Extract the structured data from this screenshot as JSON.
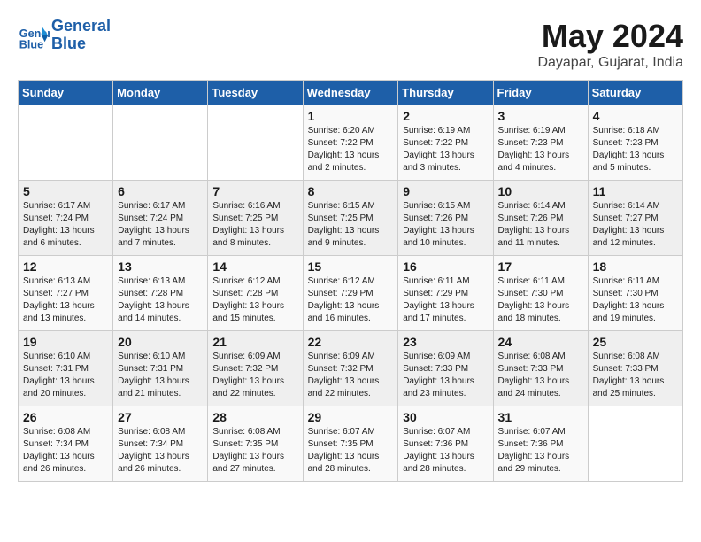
{
  "logo": {
    "line1": "General",
    "line2": "Blue"
  },
  "title": "May 2024",
  "subtitle": "Dayapar, Gujarat, India",
  "headers": [
    "Sunday",
    "Monday",
    "Tuesday",
    "Wednesday",
    "Thursday",
    "Friday",
    "Saturday"
  ],
  "weeks": [
    [
      {
        "num": "",
        "sunrise": "",
        "sunset": "",
        "daylight": ""
      },
      {
        "num": "",
        "sunrise": "",
        "sunset": "",
        "daylight": ""
      },
      {
        "num": "",
        "sunrise": "",
        "sunset": "",
        "daylight": ""
      },
      {
        "num": "1",
        "sunrise": "Sunrise: 6:20 AM",
        "sunset": "Sunset: 7:22 PM",
        "daylight": "Daylight: 13 hours and 2 minutes."
      },
      {
        "num": "2",
        "sunrise": "Sunrise: 6:19 AM",
        "sunset": "Sunset: 7:22 PM",
        "daylight": "Daylight: 13 hours and 3 minutes."
      },
      {
        "num": "3",
        "sunrise": "Sunrise: 6:19 AM",
        "sunset": "Sunset: 7:23 PM",
        "daylight": "Daylight: 13 hours and 4 minutes."
      },
      {
        "num": "4",
        "sunrise": "Sunrise: 6:18 AM",
        "sunset": "Sunset: 7:23 PM",
        "daylight": "Daylight: 13 hours and 5 minutes."
      }
    ],
    [
      {
        "num": "5",
        "sunrise": "Sunrise: 6:17 AM",
        "sunset": "Sunset: 7:24 PM",
        "daylight": "Daylight: 13 hours and 6 minutes."
      },
      {
        "num": "6",
        "sunrise": "Sunrise: 6:17 AM",
        "sunset": "Sunset: 7:24 PM",
        "daylight": "Daylight: 13 hours and 7 minutes."
      },
      {
        "num": "7",
        "sunrise": "Sunrise: 6:16 AM",
        "sunset": "Sunset: 7:25 PM",
        "daylight": "Daylight: 13 hours and 8 minutes."
      },
      {
        "num": "8",
        "sunrise": "Sunrise: 6:15 AM",
        "sunset": "Sunset: 7:25 PM",
        "daylight": "Daylight: 13 hours and 9 minutes."
      },
      {
        "num": "9",
        "sunrise": "Sunrise: 6:15 AM",
        "sunset": "Sunset: 7:26 PM",
        "daylight": "Daylight: 13 hours and 10 minutes."
      },
      {
        "num": "10",
        "sunrise": "Sunrise: 6:14 AM",
        "sunset": "Sunset: 7:26 PM",
        "daylight": "Daylight: 13 hours and 11 minutes."
      },
      {
        "num": "11",
        "sunrise": "Sunrise: 6:14 AM",
        "sunset": "Sunset: 7:27 PM",
        "daylight": "Daylight: 13 hours and 12 minutes."
      }
    ],
    [
      {
        "num": "12",
        "sunrise": "Sunrise: 6:13 AM",
        "sunset": "Sunset: 7:27 PM",
        "daylight": "Daylight: 13 hours and 13 minutes."
      },
      {
        "num": "13",
        "sunrise": "Sunrise: 6:13 AM",
        "sunset": "Sunset: 7:28 PM",
        "daylight": "Daylight: 13 hours and 14 minutes."
      },
      {
        "num": "14",
        "sunrise": "Sunrise: 6:12 AM",
        "sunset": "Sunset: 7:28 PM",
        "daylight": "Daylight: 13 hours and 15 minutes."
      },
      {
        "num": "15",
        "sunrise": "Sunrise: 6:12 AM",
        "sunset": "Sunset: 7:29 PM",
        "daylight": "Daylight: 13 hours and 16 minutes."
      },
      {
        "num": "16",
        "sunrise": "Sunrise: 6:11 AM",
        "sunset": "Sunset: 7:29 PM",
        "daylight": "Daylight: 13 hours and 17 minutes."
      },
      {
        "num": "17",
        "sunrise": "Sunrise: 6:11 AM",
        "sunset": "Sunset: 7:30 PM",
        "daylight": "Daylight: 13 hours and 18 minutes."
      },
      {
        "num": "18",
        "sunrise": "Sunrise: 6:11 AM",
        "sunset": "Sunset: 7:30 PM",
        "daylight": "Daylight: 13 hours and 19 minutes."
      }
    ],
    [
      {
        "num": "19",
        "sunrise": "Sunrise: 6:10 AM",
        "sunset": "Sunset: 7:31 PM",
        "daylight": "Daylight: 13 hours and 20 minutes."
      },
      {
        "num": "20",
        "sunrise": "Sunrise: 6:10 AM",
        "sunset": "Sunset: 7:31 PM",
        "daylight": "Daylight: 13 hours and 21 minutes."
      },
      {
        "num": "21",
        "sunrise": "Sunrise: 6:09 AM",
        "sunset": "Sunset: 7:32 PM",
        "daylight": "Daylight: 13 hours and 22 minutes."
      },
      {
        "num": "22",
        "sunrise": "Sunrise: 6:09 AM",
        "sunset": "Sunset: 7:32 PM",
        "daylight": "Daylight: 13 hours and 22 minutes."
      },
      {
        "num": "23",
        "sunrise": "Sunrise: 6:09 AM",
        "sunset": "Sunset: 7:33 PM",
        "daylight": "Daylight: 13 hours and 23 minutes."
      },
      {
        "num": "24",
        "sunrise": "Sunrise: 6:08 AM",
        "sunset": "Sunset: 7:33 PM",
        "daylight": "Daylight: 13 hours and 24 minutes."
      },
      {
        "num": "25",
        "sunrise": "Sunrise: 6:08 AM",
        "sunset": "Sunset: 7:33 PM",
        "daylight": "Daylight: 13 hours and 25 minutes."
      }
    ],
    [
      {
        "num": "26",
        "sunrise": "Sunrise: 6:08 AM",
        "sunset": "Sunset: 7:34 PM",
        "daylight": "Daylight: 13 hours and 26 minutes."
      },
      {
        "num": "27",
        "sunrise": "Sunrise: 6:08 AM",
        "sunset": "Sunset: 7:34 PM",
        "daylight": "Daylight: 13 hours and 26 minutes."
      },
      {
        "num": "28",
        "sunrise": "Sunrise: 6:08 AM",
        "sunset": "Sunset: 7:35 PM",
        "daylight": "Daylight: 13 hours and 27 minutes."
      },
      {
        "num": "29",
        "sunrise": "Sunrise: 6:07 AM",
        "sunset": "Sunset: 7:35 PM",
        "daylight": "Daylight: 13 hours and 28 minutes."
      },
      {
        "num": "30",
        "sunrise": "Sunrise: 6:07 AM",
        "sunset": "Sunset: 7:36 PM",
        "daylight": "Daylight: 13 hours and 28 minutes."
      },
      {
        "num": "31",
        "sunrise": "Sunrise: 6:07 AM",
        "sunset": "Sunset: 7:36 PM",
        "daylight": "Daylight: 13 hours and 29 minutes."
      },
      {
        "num": "",
        "sunrise": "",
        "sunset": "",
        "daylight": ""
      }
    ]
  ]
}
